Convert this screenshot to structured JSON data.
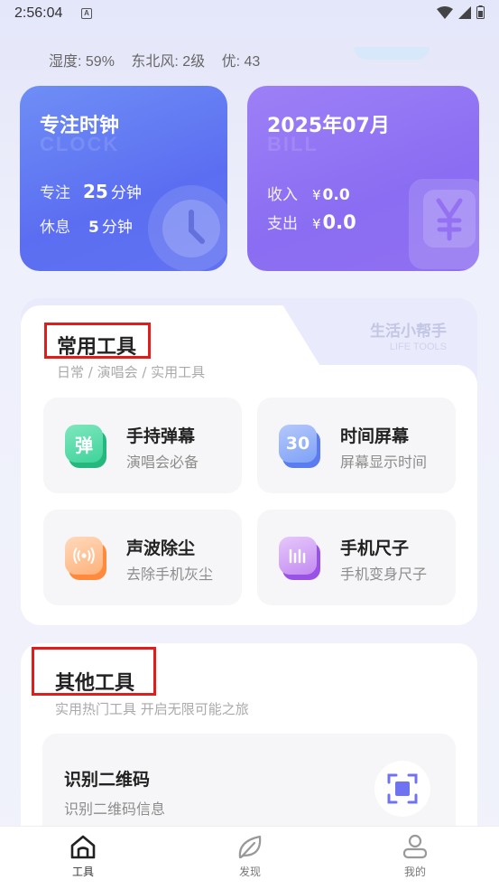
{
  "status_bar": {
    "time": "2:56:04",
    "notification_letter": "A"
  },
  "weather": {
    "humidity": "湿度: 59%",
    "wind": "东北风: 2级",
    "air_quality": "优: 43"
  },
  "clock_card": {
    "title": "专注时钟",
    "watermark": "CLOCK",
    "focus_label": "专注",
    "focus_value": "25",
    "focus_unit": "分钟",
    "rest_label": "休息",
    "rest_value": "5",
    "rest_unit": "分钟"
  },
  "bill_card": {
    "title": "2025年07月",
    "watermark": "BILL",
    "income_label": "收入",
    "income_currency": "¥",
    "income_value": "0.0",
    "expense_label": "支出",
    "expense_currency": "¥",
    "expense_value": "0.0"
  },
  "common_tools": {
    "title": "常用工具",
    "subtitle": "日常 / 演唱会 / 实用工具",
    "helper_title": "生活小帮手",
    "helper_subtitle": "LIFE TOOLS",
    "items": [
      {
        "name": "手持弹幕",
        "desc": "演唱会必备",
        "icon_text": "弹",
        "icon": "danmu-icon",
        "color": "#3fd39a",
        "color_back": "#24b87c"
      },
      {
        "name": "时间屏幕",
        "desc": "屏幕显示时间",
        "icon_text": "30",
        "icon": "calendar-30-icon",
        "color": "#7ea1f7",
        "color_back": "#5b7cf0"
      },
      {
        "name": "声波除尘",
        "desc": "去除手机灰尘",
        "icon_text": "",
        "icon": "sound-wave-icon",
        "color": "#ffb27a",
        "color_back": "#ff8a3d"
      },
      {
        "name": "手机尺子",
        "desc": "手机变身尺子",
        "icon_text": "",
        "icon": "ruler-icon",
        "color": "#c38bf2",
        "color_back": "#9a52e6"
      }
    ]
  },
  "other_tools": {
    "title": "其他工具",
    "subtitle": "实用热门工具 开启无限可能之旅",
    "items": [
      {
        "name": "识别二维码",
        "desc": "识别二维码信息",
        "icon": "qr-scan-icon"
      }
    ]
  },
  "bottom_nav": [
    {
      "label": "工具",
      "icon": "home-icon",
      "active": true
    },
    {
      "label": "发现",
      "icon": "leaf-icon",
      "active": false
    },
    {
      "label": "我的",
      "icon": "user-icon",
      "active": false
    }
  ],
  "colors": {
    "accent_blue": "#5b6ef1",
    "accent_purple": "#8a6df2",
    "highlight_red": "#e21b1b"
  }
}
